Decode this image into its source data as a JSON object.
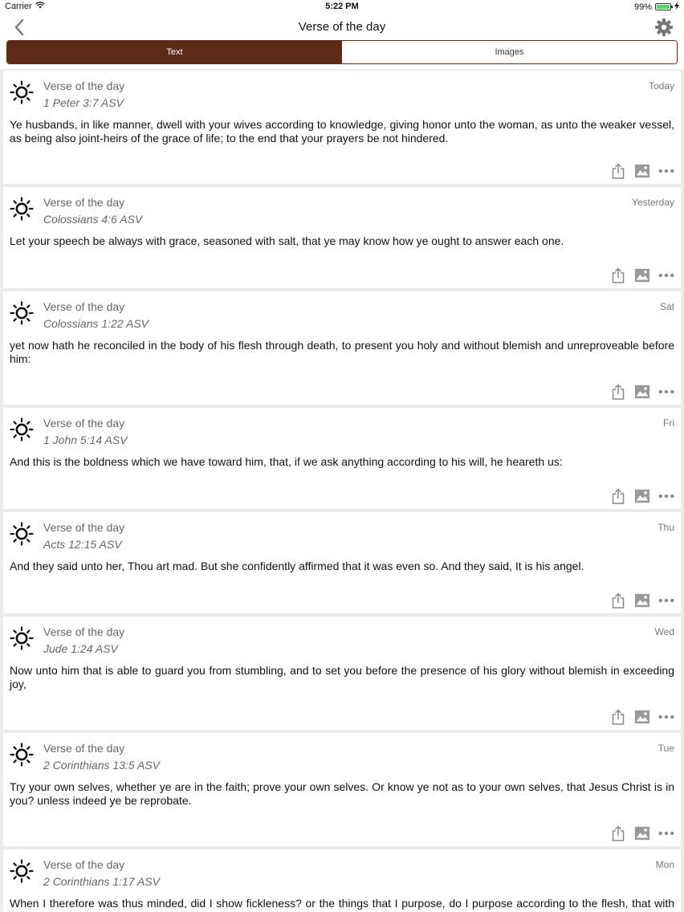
{
  "status": {
    "carrier": "Carrier",
    "time": "5:22 PM",
    "battery": "99%",
    "battery_level": 0.99
  },
  "nav": {
    "title": "Verse  of the day",
    "back_icon": "chevron-left-icon",
    "settings_icon": "gear-icon"
  },
  "tabs": [
    {
      "label": "Text",
      "active": true
    },
    {
      "label": "Images",
      "active": false
    }
  ],
  "colors": {
    "accent": "#5c2a17",
    "battery": "#4cd964"
  },
  "verses": [
    {
      "heading": "Verse of the day",
      "ref": "1 Peter 3:7 ASV",
      "date": "Today",
      "text": "Ye husbands, in like manner, dwell with your wives according to knowledge, giving honor unto the woman, as unto the weaker vessel, as being also joint-heirs of the grace of life; to the end that your prayers be not hindered."
    },
    {
      "heading": "Verse of the day",
      "ref": "Colossians 4:6 ASV",
      "date": "Yesterday",
      "text": "Let your speech be always with grace, seasoned with salt, that ye may know how ye ought to answer each one."
    },
    {
      "heading": "Verse of the day",
      "ref": "Colossians 1:22 ASV",
      "date": "Sat",
      "text": "yet now hath he reconciled in the body of his flesh through death, to present you holy and without blemish and unreproveable before him:"
    },
    {
      "heading": "Verse of the day",
      "ref": "1 John 5:14 ASV",
      "date": "Fri",
      "text": "And this is the boldness which we have toward him, that, if we ask anything according to his will, he heareth us:"
    },
    {
      "heading": "Verse of the day",
      "ref": "Acts 12:15 ASV",
      "date": "Thu",
      "text": "And they said unto her, Thou art mad. But she confidently affirmed that it was even so. And they said, It is his angel."
    },
    {
      "heading": "Verse of the day",
      "ref": "Jude 1:24 ASV",
      "date": "Wed",
      "text": "Now unto him that is able to guard you from stumbling, and to set you before the presence of his glory without blemish in exceeding joy,"
    },
    {
      "heading": "Verse of the day",
      "ref": "2 Corinthians 13:5 ASV",
      "date": "Tue",
      "text": "Try your own selves, whether ye are in the faith; prove your own selves. Or know ye not as to your own selves, that Jesus Christ is in you? unless indeed ye be reprobate."
    },
    {
      "heading": "Verse of the day",
      "ref": "2 Corinthians 1:17 ASV",
      "date": "Mon",
      "text": "When I therefore was thus minded, did I show fickleness? or the things that I purpose, do I purpose according to the flesh, that with me there should be the yea yea and the nay nay?"
    }
  ]
}
